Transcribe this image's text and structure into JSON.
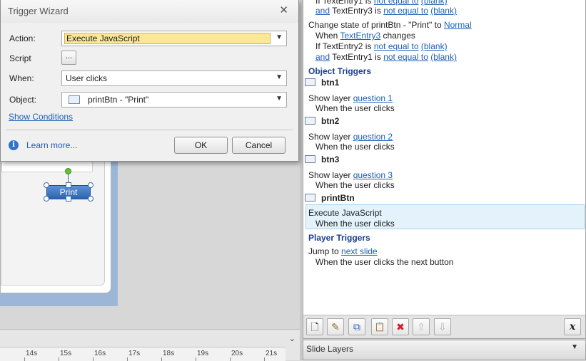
{
  "dialog": {
    "title": "Trigger Wizard",
    "close_glyph": "✕",
    "action_label": "Action:",
    "action_value": "Execute JavaScript",
    "script_label": "Script",
    "script_button": "...",
    "when_label": "When:",
    "when_value": "User clicks",
    "object_label": "Object:",
    "object_value": "printBtn - \"Print\"",
    "show_conditions": "Show Conditions",
    "learn_more": "Learn more...",
    "ok": "OK",
    "cancel": "Cancel",
    "info_glyph": "i"
  },
  "canvas": {
    "print_button_label": "Print"
  },
  "timeline": {
    "ticks": [
      "14s",
      "15s",
      "16s",
      "17s",
      "18s",
      "19s",
      "20s",
      "21s"
    ],
    "collapse_glyph": "⌄"
  },
  "triggers": {
    "top_lines": {
      "l1_a": "If TextEntry1 is",
      "l1_op": "not equal to",
      "l1_val": "(blank)",
      "l2_and": "and",
      "l2_a": "TextEntry3 is",
      "l2_op": "not equal to",
      "l2_val": "(blank)"
    },
    "change_state": {
      "action": "Change state of printBtn - \"Print\" to",
      "state": "Normal",
      "when": "When",
      "var": "TextEntry3",
      "changes": "changes",
      "c1_a": "If TextEntry2 is",
      "c1_op": "not equal to",
      "c1_val": "(blank)",
      "c2_and": "and",
      "c2_a": "TextEntry1 is",
      "c2_op": "not equal to",
      "c2_val": "(blank)"
    },
    "object_triggers_heading": "Object Triggers",
    "objects": [
      {
        "name": "btn1",
        "action": "Show layer",
        "target": "question 1",
        "when": "When the user clicks"
      },
      {
        "name": "btn2",
        "action": "Show layer",
        "target": "question 2",
        "when": "When the user clicks"
      },
      {
        "name": "btn3",
        "action": "Show layer",
        "target": "question 3",
        "when": "When the user clicks"
      },
      {
        "name": "printBtn",
        "action": "Execute JavaScript",
        "target": "",
        "when": "When the user clicks"
      }
    ],
    "player_triggers_heading": "Player Triggers",
    "player": {
      "action": "Jump to",
      "target": "next slide",
      "when": "When the user clicks the next button"
    }
  },
  "toolbar": {
    "new_icon": "🗋",
    "edit_icon": "✎",
    "copy_icon": "⧉",
    "paste_icon": "📋",
    "delete_icon": "✖",
    "up_icon": "⇧",
    "down_icon": "⇩",
    "variables_icon": "x"
  },
  "slide_layers": {
    "label": "Slide Layers",
    "arrow": "▼"
  }
}
